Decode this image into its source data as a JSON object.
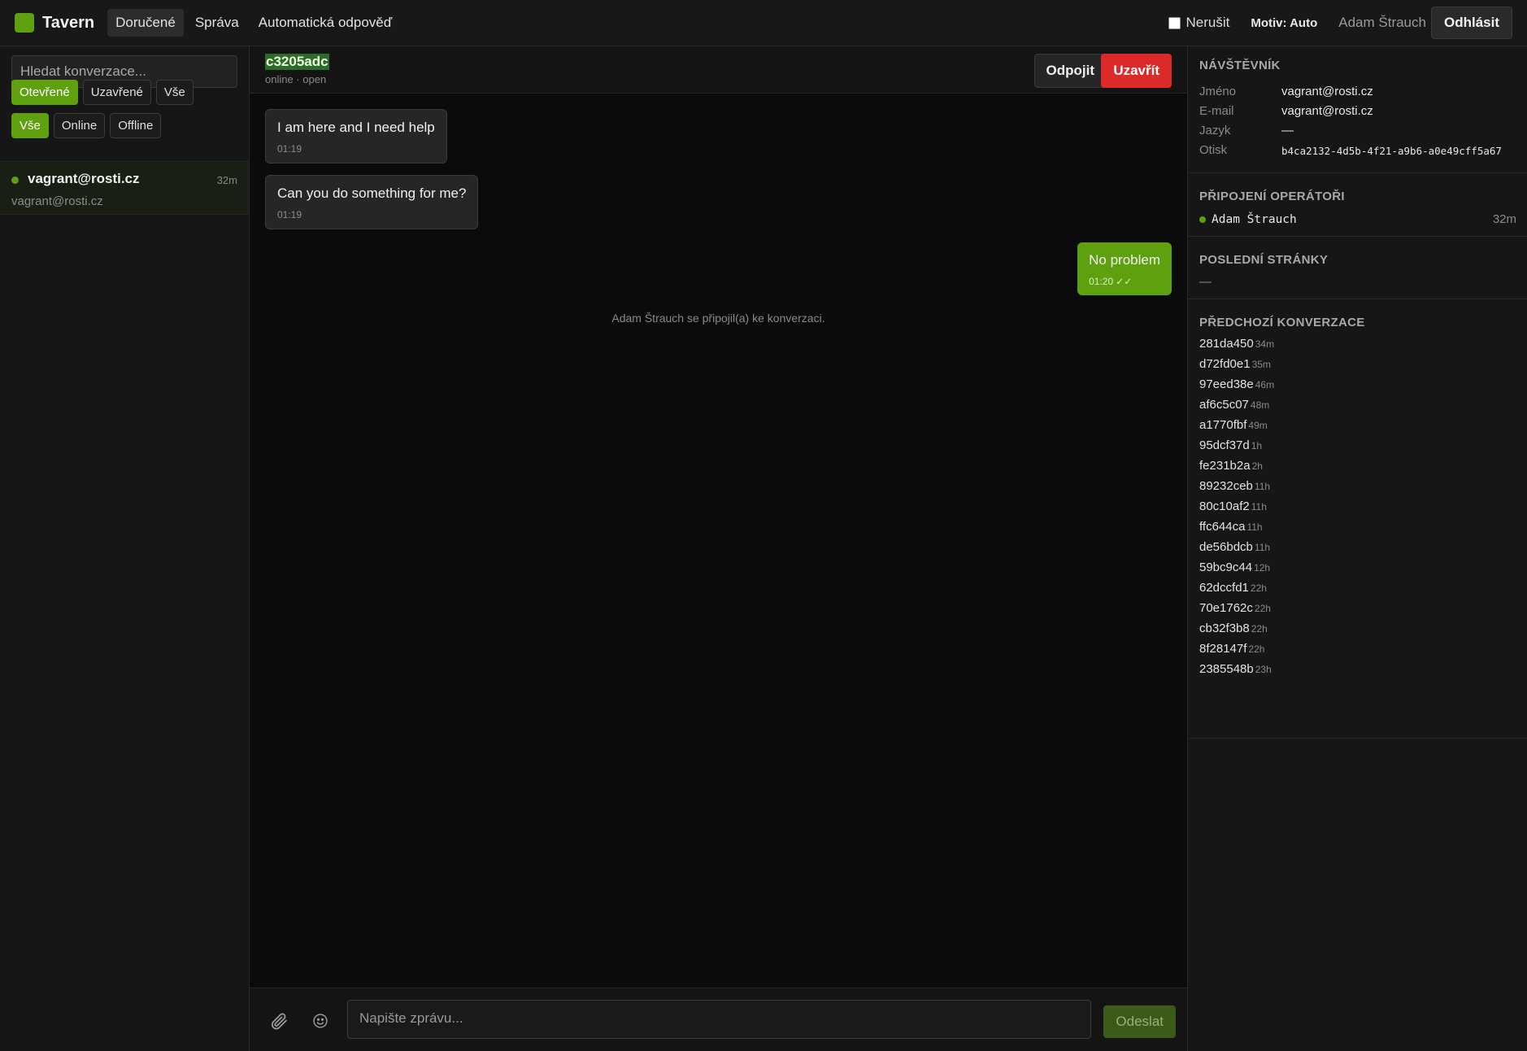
{
  "app": {
    "name": "Tavern"
  },
  "nav": [
    {
      "label": "Doručené",
      "active": true
    },
    {
      "label": "Správa",
      "active": false
    },
    {
      "label": "Automatická odpověď",
      "active": false
    }
  ],
  "topbar": {
    "dnd_label": "Nerušit",
    "dnd_checked": false,
    "theme_label": "Motiv: Auto",
    "user_name": "Adam Štrauch",
    "logout_label": "Odhlásit"
  },
  "sidebar": {
    "search_placeholder": "Hledat konverzace...",
    "status_filters": [
      {
        "label": "Otevřené",
        "active": true
      },
      {
        "label": "Uzavřené",
        "active": false
      },
      {
        "label": "Vše",
        "active": false
      }
    ],
    "presence_filters": [
      {
        "label": "Vše",
        "active": true
      },
      {
        "label": "Online",
        "active": false
      },
      {
        "label": "Offline",
        "active": false
      }
    ],
    "conversations": [
      {
        "title": "vagrant@rosti.cz",
        "subtitle": "vagrant@rosti.cz",
        "time": "32m",
        "online": true
      }
    ]
  },
  "chat": {
    "id": "c3205adc",
    "status": "online · open",
    "disconnect_label": "Odpojit",
    "close_label": "Uzavřít",
    "messages": [
      {
        "direction": "in",
        "text": "I am here and I need help",
        "time": "01:19"
      },
      {
        "direction": "in",
        "text": "Can you do something for me?",
        "time": "01:19"
      },
      {
        "direction": "out",
        "text": "No problem",
        "time": "01:20",
        "ticks": "✓✓"
      }
    ],
    "system_note": "Adam Štrauch se připojil(a) ke konverzaci.",
    "input_placeholder": "Napište zprávu...",
    "send_label": "Odeslat"
  },
  "visitor": {
    "section_title": "NÁVŠTĚVNÍK",
    "fields": [
      {
        "key": "Jméno",
        "value": "vagrant@rosti.cz"
      },
      {
        "key": "E-mail",
        "value": "vagrant@rosti.cz"
      },
      {
        "key": "Jazyk",
        "value": "—"
      },
      {
        "key": "Otisk",
        "value": "b4ca2132-4d5b-4f21-a9b6-a0e49cff5a67"
      }
    ]
  },
  "operators": {
    "section_title": "PŘIPOJENÍ OPERÁTOŘI",
    "items": [
      {
        "name": "Adam Štrauch",
        "time": "32m"
      }
    ]
  },
  "last_pages": {
    "section_title": "POSLEDNÍ STRÁNKY",
    "empty": "—"
  },
  "previous": {
    "section_title": "PŘEDCHOZÍ KONVERZACE",
    "items": [
      {
        "id": "281da450",
        "age": "34m"
      },
      {
        "id": "d72fd0e1",
        "age": "35m"
      },
      {
        "id": "97eed38e",
        "age": "46m"
      },
      {
        "id": "af6c5c07",
        "age": "48m"
      },
      {
        "id": "a1770fbf",
        "age": "49m"
      },
      {
        "id": "95dcf37d",
        "age": "1h"
      },
      {
        "id": "fe231b2a",
        "age": "2h"
      },
      {
        "id": "89232ceb",
        "age": "11h"
      },
      {
        "id": "80c10af2",
        "age": "11h"
      },
      {
        "id": "ffc644ca",
        "age": "11h"
      },
      {
        "id": "de56bdcb",
        "age": "11h"
      },
      {
        "id": "59bc9c44",
        "age": "12h"
      },
      {
        "id": "62dccfd1",
        "age": "22h"
      },
      {
        "id": "70e1762c",
        "age": "22h"
      },
      {
        "id": "cb32f3b8",
        "age": "22h"
      },
      {
        "id": "8f28147f",
        "age": "22h"
      },
      {
        "id": "2385548b",
        "age": "23h"
      }
    ]
  },
  "colors": {
    "accent": "#5fa00e",
    "danger": "#dc2a2a",
    "background": "#0b0b0b"
  }
}
